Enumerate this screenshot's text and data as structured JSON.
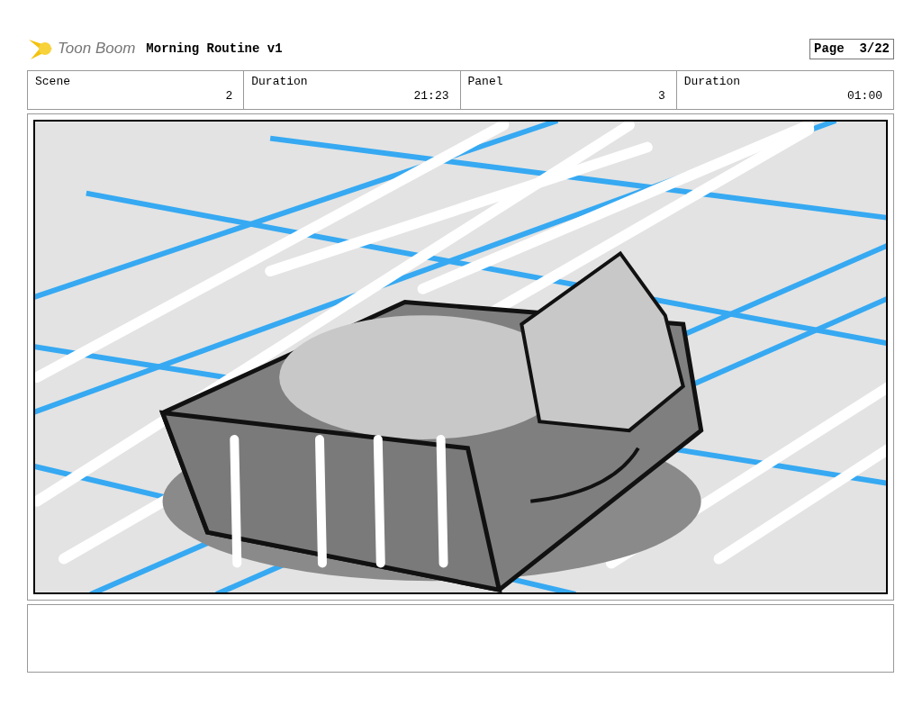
{
  "logo": {
    "text": "Toon Boom"
  },
  "title": "Morning Routine v1",
  "page": "Page  3/22",
  "fields": [
    {
      "label": "Scene",
      "value": "2"
    },
    {
      "label": "Duration",
      "value": "21:23"
    },
    {
      "label": "Panel",
      "value": "3"
    },
    {
      "label": "Duration",
      "value": "01:00"
    }
  ]
}
